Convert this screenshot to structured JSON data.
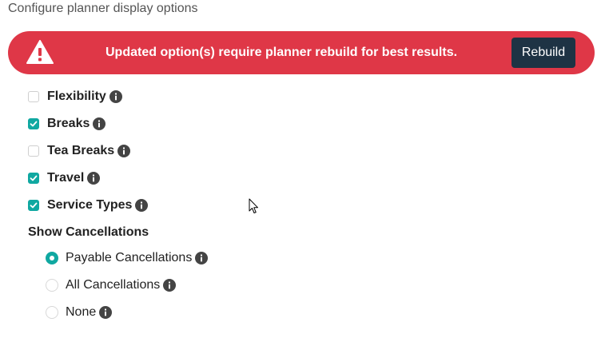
{
  "header": {
    "subtitle": "Configure planner display options"
  },
  "alert": {
    "icon": "warning-triangle-icon",
    "message": "Updated option(s) require planner rebuild for best results.",
    "button_label": "Rebuild",
    "background_color": "#df3747",
    "button_color": "#1e3344"
  },
  "options": [
    {
      "label": "Flexibility",
      "checked": false,
      "icon": "info-icon"
    },
    {
      "label": "Breaks",
      "checked": true,
      "icon": "info-icon"
    },
    {
      "label": "Tea Breaks",
      "checked": false,
      "icon": "info-icon"
    },
    {
      "label": "Travel",
      "checked": true,
      "icon": "info-icon"
    },
    {
      "label": "Service Types",
      "checked": true,
      "icon": "info-icon"
    }
  ],
  "cancellations": {
    "title": "Show Cancellations",
    "selected": "Payable Cancellations",
    "choices": [
      {
        "label": "Payable Cancellations",
        "selected": true,
        "icon": "info-icon"
      },
      {
        "label": "All Cancellations",
        "selected": false,
        "icon": "info-icon"
      },
      {
        "label": "None",
        "selected": false,
        "icon": "info-icon"
      }
    ]
  },
  "accent_color": "#10a8a1"
}
